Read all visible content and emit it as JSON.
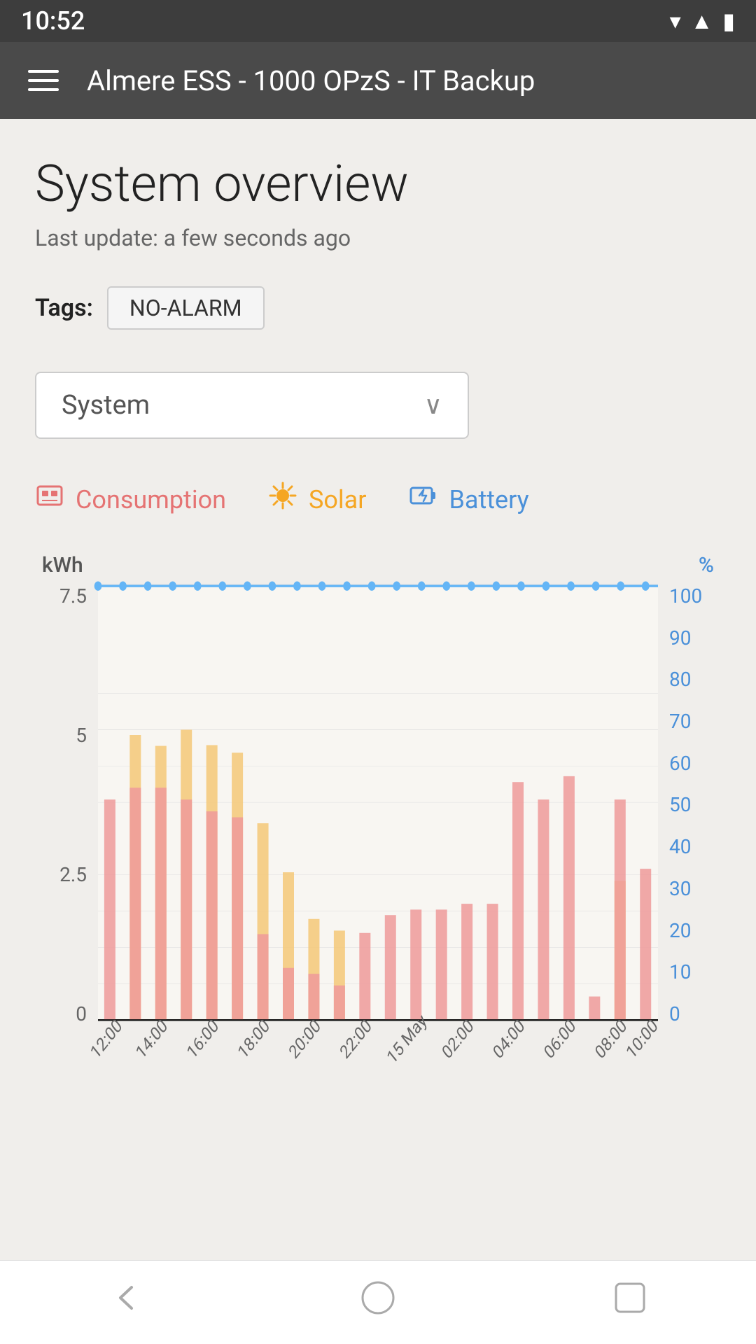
{
  "statusBar": {
    "time": "10:52",
    "icons": [
      "wifi",
      "signal",
      "battery-charging"
    ]
  },
  "appBar": {
    "title": "Almere ESS - 1000 OPzS - IT Backup"
  },
  "page": {
    "title": "System overview",
    "lastUpdate": "Last update: a few seconds ago",
    "tagsLabel": "Tags:",
    "tag": "NO-ALARM"
  },
  "dropdown": {
    "label": "System",
    "chevron": "∨"
  },
  "legend": {
    "items": [
      {
        "id": "consumption",
        "icon": "🔌",
        "label": "Consumption",
        "iconAlt": "consumption-icon"
      },
      {
        "id": "solar",
        "icon": "☀",
        "label": "Solar",
        "iconAlt": "solar-icon"
      },
      {
        "id": "battery",
        "icon": "🔋",
        "label": "Battery",
        "iconAlt": "battery-icon"
      }
    ]
  },
  "chart": {
    "yLeftLabel": "kWh",
    "yRightLabel": "%",
    "yLeftValues": [
      "7.5",
      "5",
      "2.5",
      "0"
    ],
    "yRightValues": [
      "100",
      "90",
      "80",
      "70",
      "60",
      "50",
      "40",
      "30",
      "20",
      "10",
      "0"
    ],
    "xLabels": [
      "12:00",
      "14:00",
      "16:00",
      "18:00",
      "20:00",
      "22:00",
      "15 May",
      "02:00",
      "04:00",
      "06:00",
      "08:00",
      "10:00"
    ],
    "batteryLine": 100,
    "bars": [
      {
        "x": 0,
        "consumption": 3.8,
        "solar": 0
      },
      {
        "x": 1,
        "consumption": 4.0,
        "solar": 4.9
      },
      {
        "x": 2,
        "consumption": 4.0,
        "solar": 4.2
      },
      {
        "x": 3,
        "consumption": 3.8,
        "solar": 5.0
      },
      {
        "x": 4,
        "consumption": 3.6,
        "solar": 4.0
      },
      {
        "x": 5,
        "consumption": 3.5,
        "solar": 4.6
      },
      {
        "x": 6,
        "consumption": 1.2,
        "solar": 3.4
      },
      {
        "x": 7,
        "consumption": 0.9,
        "solar": 2.3
      },
      {
        "x": 8,
        "consumption": 0.8,
        "solar": 1.2
      },
      {
        "x": 9,
        "consumption": 0.6,
        "solar": 1.0
      },
      {
        "x": 10,
        "consumption": 1.5,
        "solar": 0
      },
      {
        "x": 11,
        "consumption": 1.8,
        "solar": 0
      },
      {
        "x": 12,
        "consumption": 1.9,
        "solar": 0
      },
      {
        "x": 13,
        "consumption": 1.9,
        "solar": 0
      },
      {
        "x": 14,
        "consumption": 2.0,
        "solar": 0
      },
      {
        "x": 15,
        "consumption": 2.0,
        "solar": 0
      },
      {
        "x": 16,
        "consumption": 4.1,
        "solar": 0
      },
      {
        "x": 17,
        "consumption": 3.8,
        "solar": 0
      },
      {
        "x": 18,
        "consumption": 4.2,
        "solar": 0
      },
      {
        "x": 19,
        "consumption": 0.4,
        "solar": 0
      },
      {
        "x": 20,
        "consumption": 3.8,
        "solar": 2.4
      },
      {
        "x": 21,
        "consumption": 2.6,
        "solar": 0
      }
    ]
  },
  "bottomNav": {
    "items": [
      "back",
      "home",
      "menu"
    ]
  }
}
